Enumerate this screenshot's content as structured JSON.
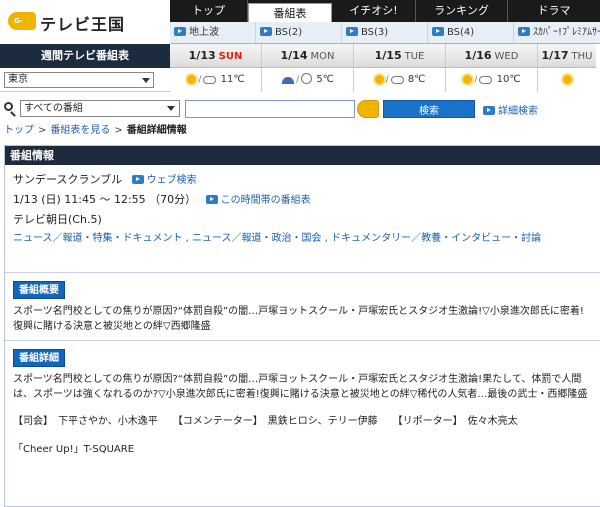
{
  "logo": {
    "mark": "G-GUIDE",
    "name": "テレビ王国"
  },
  "nav": {
    "tabs": [
      {
        "label": "トップ",
        "active": false
      },
      {
        "label": "番組表",
        "active": true
      },
      {
        "label": "イチオシ!",
        "active": false
      },
      {
        "label": "ランキング",
        "active": false
      },
      {
        "label": "ドラマ",
        "active": false
      }
    ],
    "sub": [
      "地上波",
      "BS(2)",
      "BS(3)",
      "BS(4)",
      "ｽｶﾊﾟｰ!ﾌﾟﾚﾐｱﾑｻｰ"
    ]
  },
  "weekly": {
    "title": "週間テレビ番組表",
    "region": "東京",
    "days": [
      {
        "date": "1/13",
        "dow": "SUN",
        "temp": "11℃"
      },
      {
        "date": "1/14",
        "dow": "MON",
        "temp": "5℃"
      },
      {
        "date": "1/15",
        "dow": "TUE",
        "temp": "8℃"
      },
      {
        "date": "1/16",
        "dow": "WED",
        "temp": "10℃"
      },
      {
        "date": "1/17",
        "dow": "THU",
        "temp": ""
      }
    ]
  },
  "search": {
    "scope": "すべての番組",
    "value": "",
    "button": "検索",
    "advanced": "詳細検索"
  },
  "breadcrumb": {
    "top": "トップ",
    "guide": "番組表を見る",
    "current": "番組詳細情報"
  },
  "program": {
    "section_title": "番組情報",
    "title": "サンデースクランブル",
    "web_search": "ウェブ検索",
    "datetime": "1/13 (日) 11:45 ～ 12:55 （70分）",
    "timeslot_link": "この時間帯の番組表",
    "channel": "テレビ朝日(Ch.5)",
    "genres": "ニュース／報道・特集・ドキュメント , ニュース／報道・政治・国会 , ドキュメンタリー／教養・インタビュー・討論",
    "summary_label": "番組概要",
    "summary": "スポーツ名門校としての焦りが原因?“体罰自殺”の闇…戸塚ヨットスクール・戸塚宏氏とスタジオ生激論!▽小泉進次郎氏に密着!復興に賭ける決意と被災地との絆▽西郷隆盛",
    "detail_label": "番組詳細",
    "detail": "スポーツ名門校としての焦りが原因?“体罰自殺”の闇…戸塚ヨットスクール・戸塚宏氏とスタジオ生激論!果たして、体罰で人間は、スポーツは強くなれるのか?▽小泉進次郎氏に密着!復興に賭ける決意と被災地との絆▽稀代の人気者…最後の武士・西郷隆盛",
    "credits": "【司会】　下平さやか、小木逸平　　【コメンテーター】　黒鉄ヒロシ、テリー伊藤　　【リポーター】　佐々木亮太",
    "music": "「Cheer Up!」T-SQUARE"
  }
}
